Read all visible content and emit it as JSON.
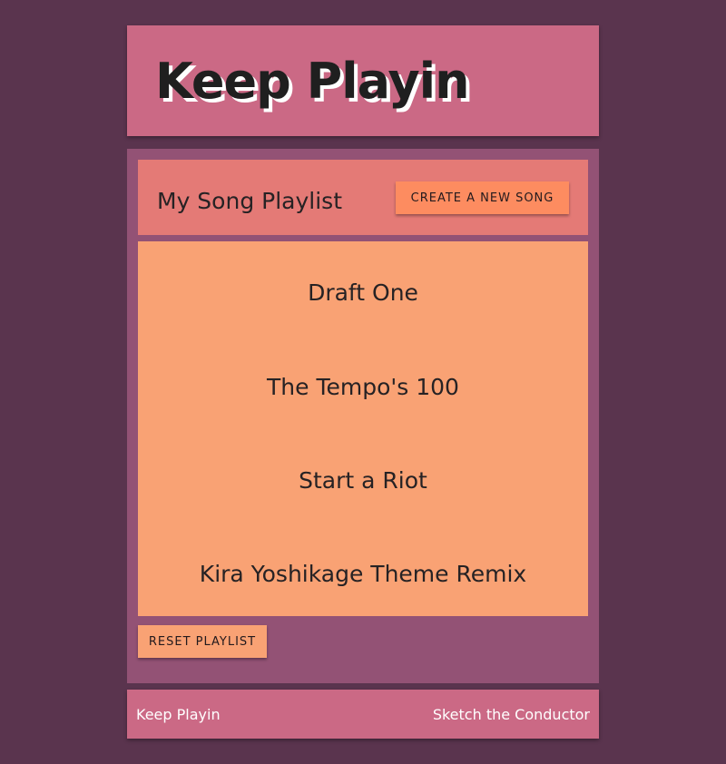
{
  "header": {
    "title": "Keep Playin"
  },
  "playlist": {
    "title": "My Song Playlist",
    "create_label": "Create a new song",
    "songs": [
      "Draft One",
      "The Tempo's 100",
      "Start a Riot",
      "Kira Yoshikage Theme Remix"
    ],
    "reset_label": "Reset playlist"
  },
  "footer": {
    "left_text": "Keep Playin",
    "right_text": "Sketch the Conductor"
  },
  "colors": {
    "page_background": "#5a344e",
    "header_background": "#cb6985",
    "main_background": "#935275",
    "playlist_header_background": "#e47a76",
    "song_list_background": "#f9a274",
    "create_button_background": "#fd8c60",
    "reset_button_background": "#f9a274"
  }
}
